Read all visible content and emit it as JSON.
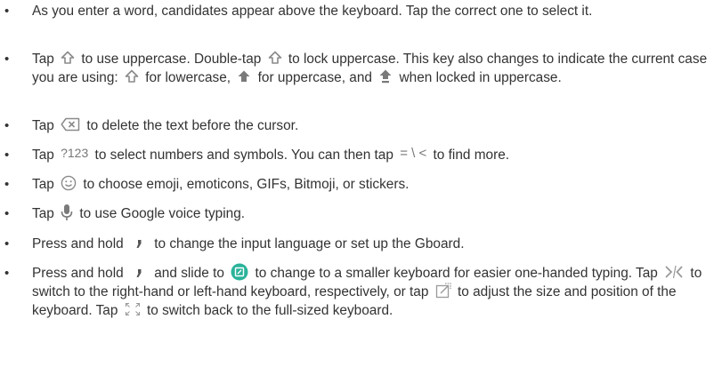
{
  "items": [
    {
      "t1": "As you enter a word, candidates appear above the keyboard. Tap the correct one to select it."
    },
    {
      "t1": "Tap",
      "t2": "to use uppercase. Double-tap",
      "t3": "to lock uppercase. This key also changes to indicate the current case you are using:",
      "t4": "for lowercase,",
      "t5": "for uppercase, and",
      "t6": "when locked in uppercase."
    },
    {
      "t1": "Tap",
      "t2": "to delete the text before the cursor."
    },
    {
      "t1": "Tap",
      "icon1": "?123",
      "t2": "to select numbers and symbols. You can then tap",
      "icon2": "= \\ <",
      "t3": "to find more."
    },
    {
      "t1": "Tap",
      "t2": "to choose emoji, emoticons, GIFs, Bitmoji, or stickers."
    },
    {
      "t1": "Tap",
      "t2": "to use Google voice typing."
    },
    {
      "t1": "Press and hold",
      "t2": "to change the input language or set up the Gboard."
    },
    {
      "t1": "Press and hold",
      "t2": "and slide to",
      "t3": "to change to a smaller keyboard for easier one-handed typing. Tap",
      "t4": "to switch to the right-hand or left-hand keyboard, respectively, or tap",
      "t5": "to adjust the size and position of the keyboard. Tap",
      "t6": "to switch back to the full-sized keyboard."
    }
  ],
  "colors": {
    "text": "#333333",
    "icon_grey": "#8a8a8a",
    "icon_blue": "#2ba8cf",
    "icon_green": "#2bb39b"
  },
  "icons": [
    "shift-outline-icon",
    "shift-filled-icon",
    "shift-locked-icon",
    "backspace-icon",
    "emoji-icon",
    "microphone-icon",
    "comma-key-icon",
    "one-handed-mode-icon",
    "chevron-switch-icon",
    "resize-icon",
    "expand-icon"
  ]
}
